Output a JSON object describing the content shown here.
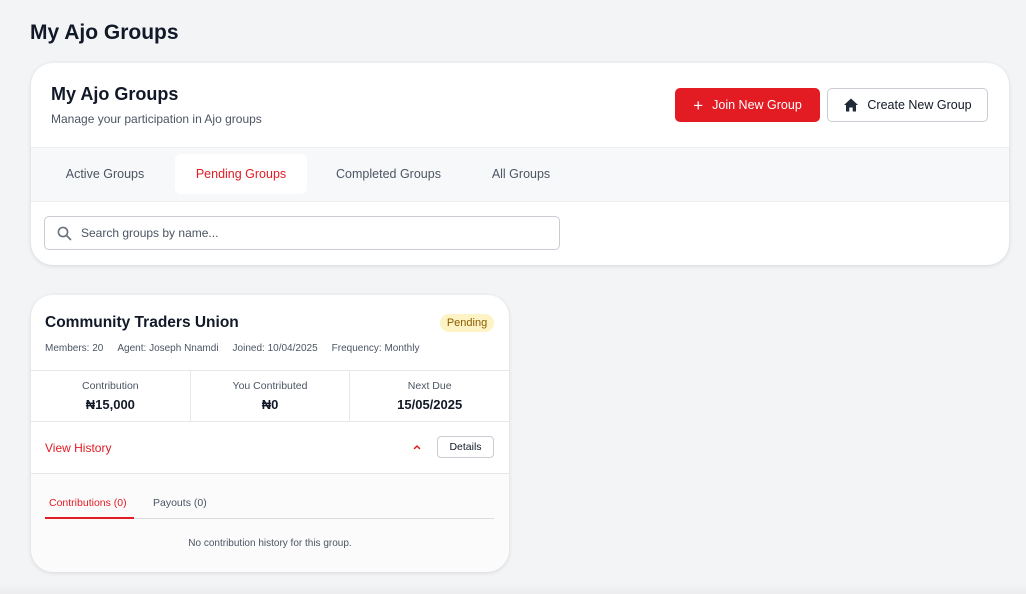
{
  "page": {
    "title": "My Ajo Groups"
  },
  "header": {
    "title": "My Ajo Groups",
    "subtitle": "Manage your participation in Ajo groups",
    "join_button": {
      "label": "Join New Group",
      "icon": "plus-icon"
    },
    "create_button": {
      "label": "Create New Group",
      "icon": "home-icon"
    }
  },
  "tabs": [
    {
      "label": "Active Groups",
      "active": false
    },
    {
      "label": "Pending Groups",
      "active": true
    },
    {
      "label": "Completed Groups",
      "active": false
    },
    {
      "label": "All Groups",
      "active": false
    }
  ],
  "search": {
    "placeholder": "Search groups by name...",
    "value": "",
    "icon": "search-icon"
  },
  "group": {
    "name": "Community Traders Union",
    "status": "Pending",
    "meta": {
      "members_label": "Members:",
      "members": "20",
      "agent_label": "Agent:",
      "agent": "Joseph Nnamdi",
      "joined_label": "Joined:",
      "joined": "10/04/2025",
      "frequency_label": "Frequency:",
      "frequency": "Monthly"
    },
    "stats": [
      {
        "label": "Contribution",
        "value": "₦15,000"
      },
      {
        "label": "You Contributed",
        "value": "₦0"
      },
      {
        "label": "Next Due",
        "value": "15/05/2025"
      }
    ],
    "view_history_label": "View History",
    "details_label": "Details",
    "history_tabs": [
      {
        "label": "Contributions (0)",
        "active": true
      },
      {
        "label": "Payouts (0)",
        "active": false
      }
    ],
    "empty_message": "No contribution history for this group."
  },
  "colors": {
    "accent": "#e31b23",
    "background": "#f3f4f6",
    "badge_bg": "#fdf3c4"
  }
}
